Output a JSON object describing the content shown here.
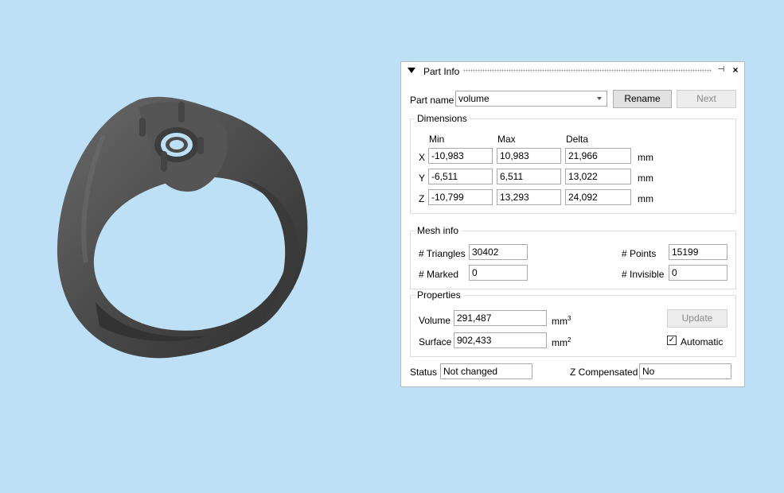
{
  "panel": {
    "title": "Part Info",
    "part_name_label": "Part name",
    "part_name_value": "volume",
    "rename_label": "Rename",
    "next_label": "Next",
    "dimensions": {
      "title": "Dimensions",
      "col_min": "Min",
      "col_max": "Max",
      "col_delta": "Delta",
      "unit": "mm",
      "rows": [
        {
          "axis": "X",
          "min": "-10,983",
          "max": "10,983",
          "delta": "21,966"
        },
        {
          "axis": "Y",
          "min": "-6,511",
          "max": "6,511",
          "delta": "13,022"
        },
        {
          "axis": "Z",
          "min": "-10,799",
          "max": "13,293",
          "delta": "24,092"
        }
      ]
    },
    "mesh_info": {
      "title": "Mesh info",
      "triangles_label": "# Triangles",
      "triangles_value": "30402",
      "points_label": "# Points",
      "points_value": "15199",
      "marked_label": "# Marked",
      "marked_value": "0",
      "invisible_label": "# Invisible",
      "invisible_value": "0"
    },
    "properties": {
      "title": "Properties",
      "volume_label": "Volume",
      "volume_value": "291,487",
      "volume_unit": "mm",
      "volume_unit_exp": "3",
      "surface_label": "Surface",
      "surface_value": "902,433",
      "surface_unit": "mm",
      "surface_unit_exp": "2",
      "update_label": "Update",
      "automatic_label": "Automatic",
      "automatic_checked": true
    },
    "status_label": "Status",
    "status_value": "Not changed",
    "zcomp_label": "Z Compensated",
    "zcomp_value": "No"
  },
  "colors": {
    "background": "#bde0f7",
    "model": "#4a4a4a"
  }
}
